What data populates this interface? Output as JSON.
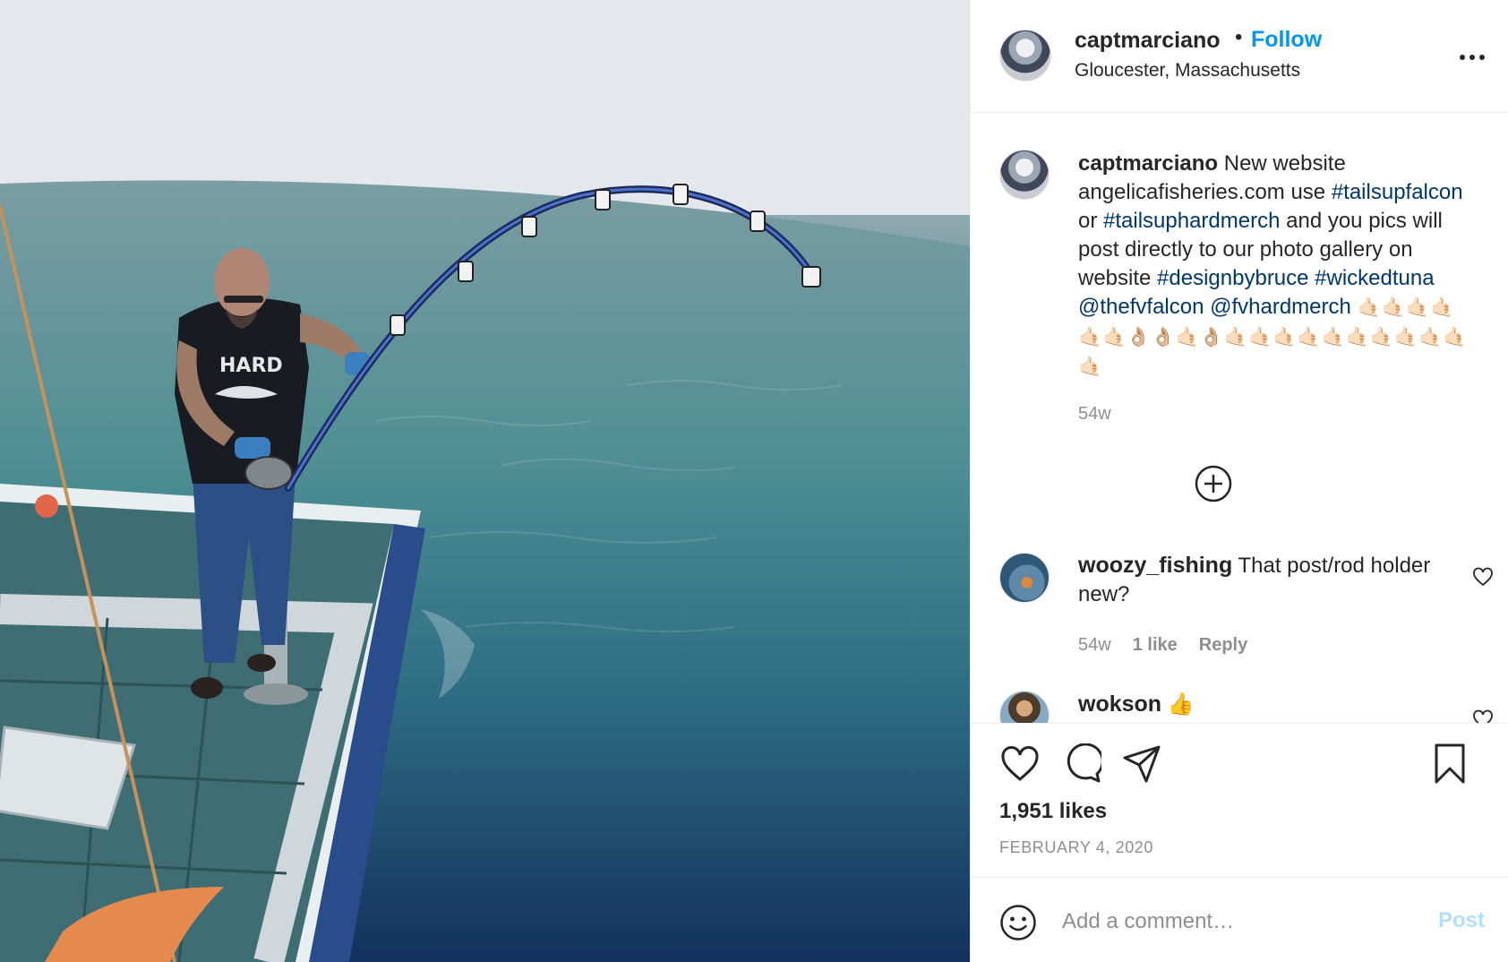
{
  "post": {
    "photo_alt": "Man fishing off the stern of a boat with a bent rod",
    "author": "captmarciano",
    "dot": "•",
    "follow_label": "Follow",
    "location": "Gloucester, Massachusetts",
    "caption": {
      "username": "captmarciano",
      "text_1": "New website angelicafisheries.com use",
      "tag_1": "#tailsupfalcon",
      "text_2": "or",
      "tag_2": "#tailsuphardmerch",
      "text_3": "and you pics will post directly to our photo gallery on website",
      "tag_3": "#designbybruce",
      "tag_4": "#wickedtuna",
      "mention_1": "@thefvfalcon",
      "mention_2": "@fvhardmerch",
      "emojis_line_1": "🤙🏻🤙🏻🤙🏻🤙🏻",
      "emojis_line_2": "🤙🏻🤙🏻👌🏼👌🏼🤙🏻👌🏼🤙🏻🤙🏻🤙🏻🤙🏻🤙🏻🤙🏻🤙🏻🤙🏻🤙🏻🤙🏻🤙🏻",
      "time": "54w"
    },
    "comments": [
      {
        "username": "woozy_fishing",
        "text": "That post/rod holder new?",
        "time": "54w",
        "likes": "1 like",
        "reply_label": "Reply"
      },
      {
        "username": "wokson",
        "text": "👍"
      }
    ],
    "likes": "1,951 likes",
    "date": "FEBRUARY 4, 2020",
    "comment_placeholder": "Add a comment…",
    "post_label": "Post"
  },
  "icons": {
    "more": "more-options-icon",
    "add": "plus-circle-icon",
    "like": "heart-icon",
    "comment": "comment-bubble-icon",
    "share": "paper-plane-icon",
    "save": "bookmark-icon",
    "emoji": "smiley-icon"
  },
  "colors": {
    "link_blue": "#0095f6",
    "hashtag": "#00376b",
    "muted": "#8e8e8e",
    "post_disabled": "#b2dffc"
  }
}
